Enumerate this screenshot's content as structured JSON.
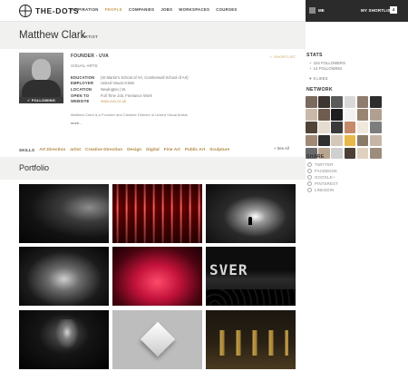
{
  "brand": {
    "name": "THE-DOTS"
  },
  "nav": {
    "items": [
      {
        "label": "INSPIRATION",
        "active": false
      },
      {
        "label": "PEOPLE",
        "active": true
      },
      {
        "label": "COMPANIES",
        "active": false
      },
      {
        "label": "JOBS",
        "active": false
      },
      {
        "label": "WORKSPACES",
        "active": false
      },
      {
        "label": "COURSES",
        "active": false
      }
    ],
    "user_label": "ME",
    "shortlist_label": "MY SHORTLIST",
    "shortlist_count": "4",
    "accent": "#c8a05a"
  },
  "profile": {
    "name": "Matthew Clark",
    "role": "ARTIST",
    "follow_label": "FOLLOWING",
    "shortlist_label": "SHORTLIST",
    "headline": "FOUNDER - UVA",
    "discipline": "VISUAL ARTS",
    "details": [
      {
        "label": "EDUCATION",
        "value": "(St Martin's School of Art, Cumberwell School of Art)",
        "link": false
      },
      {
        "label": "EMPLOYER",
        "value": "United Visual Artists",
        "link": false
      },
      {
        "label": "LOCATION",
        "value": "Newington | W.",
        "link": false
      },
      {
        "label": "OPEN TO",
        "value": "Full Time Job, Freelance Work",
        "link": false
      },
      {
        "label": "WEBSITE",
        "value": "www.uva.co.uk",
        "link": true
      }
    ],
    "bio": "Matthew Clark is a Founder and Creative Director of United Visual Artists",
    "more_label": "more..."
  },
  "skills": {
    "label": "SKILLS",
    "items": [
      "Art Direction",
      "artist",
      "Creative Direction",
      "Design",
      "Digital",
      "Fine Art",
      "Public Art",
      "Sculpture"
    ],
    "see_all_label": "See All"
  },
  "portfolio": {
    "title": "Portfolio",
    "tile6_text": "SVER"
  },
  "sidebar": {
    "stats_title": "STATS",
    "stats": [
      {
        "icon": "followers-icon",
        "text": "104 FOLLOWERS"
      },
      {
        "icon": "following-icon",
        "text": "14 FOLLOWING"
      },
      {
        "icon": "likes-icon",
        "text": "5 LIKES"
      }
    ],
    "network_title": "NETWORK",
    "network_colors": [
      "#7b6a5e",
      "#3d3530",
      "#5a5a5a",
      "#d9d9d9",
      "#8e7d6f",
      "#2d2d2d",
      "#c9b9a8",
      "#6f5c4e",
      "#1e1e1e",
      "#f2f2f2",
      "#9a8572",
      "#b0a090",
      "#504438",
      "#e6dccf",
      "#3a3a3a",
      "#c58a6a",
      "#f0e8dc",
      "#7d7d7d",
      "#a08a75",
      "#2f2f2f",
      "#d4c8b8",
      "#e8b84a",
      "#8a7a6a",
      "#c7b6a6",
      "#6a6a6a",
      "#b9a58f",
      "#cfcfcf",
      "#4d3f35",
      "#e0d0c0",
      "#9c8c7c"
    ],
    "share_title": "SHARE",
    "share_items": [
      "TWITTER",
      "FACEBOOK",
      "GOOGLE+",
      "PINTEREST",
      "LINKEDIN"
    ]
  }
}
